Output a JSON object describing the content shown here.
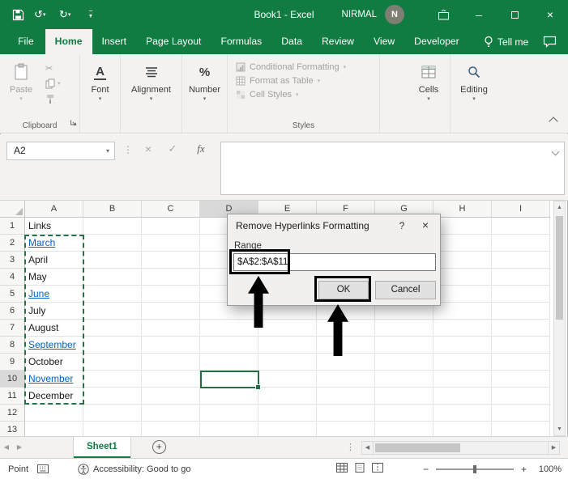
{
  "titlebar": {
    "title": "Book1 - Excel",
    "user": "NIRMAL",
    "avatar_initial": "N"
  },
  "tabs": {
    "file": "File",
    "items": [
      "Home",
      "Insert",
      "Page Layout",
      "Formulas",
      "Data",
      "Review",
      "View",
      "Developer"
    ],
    "active": "Home",
    "tell_me": "Tell me"
  },
  "ribbon": {
    "paste_label": "Paste",
    "clipboard_group": "Clipboard",
    "font_label": "Font",
    "alignment_label": "Alignment",
    "number_label": "Number",
    "styles": {
      "conditional_formatting": "Conditional Formatting",
      "format_as_table": "Format as Table",
      "cell_styles": "Cell Styles",
      "group_label": "Styles"
    },
    "cells_label": "Cells",
    "editing_label": "Editing"
  },
  "formula_bar": {
    "name_box": "A2",
    "fx_label": "fx"
  },
  "grid": {
    "column_headers": [
      "A",
      "B",
      "C",
      "D",
      "E",
      "F",
      "G",
      "H",
      "I"
    ],
    "row_headers": [
      "1",
      "2",
      "3",
      "4",
      "5",
      "6",
      "7",
      "8",
      "9",
      "10",
      "11",
      "12",
      "13"
    ],
    "column_a": [
      {
        "row": "1",
        "text": "Links",
        "hyperlink": false
      },
      {
        "row": "2",
        "text": "March",
        "hyperlink": true
      },
      {
        "row": "3",
        "text": "April",
        "hyperlink": false
      },
      {
        "row": "4",
        "text": "May",
        "hyperlink": false
      },
      {
        "row": "5",
        "text": "June",
        "hyperlink": true
      },
      {
        "row": "6",
        "text": "July",
        "hyperlink": false
      },
      {
        "row": "7",
        "text": "August",
        "hyperlink": false
      },
      {
        "row": "8",
        "text": "September",
        "hyperlink": true
      },
      {
        "row": "9",
        "text": "October",
        "hyperlink": false
      },
      {
        "row": "10",
        "text": "November",
        "hyperlink": true
      },
      {
        "row": "11",
        "text": "December",
        "hyperlink": false
      }
    ],
    "active_cell": "D10",
    "selection_range": "A2:A11"
  },
  "dialog": {
    "title": "Remove Hyperlinks Formatting",
    "range_label": "Range",
    "range_value": "$A$2:$A$11",
    "ok_label": "OK",
    "cancel_label": "Cancel"
  },
  "sheet_bar": {
    "sheet_name": "Sheet1"
  },
  "status_bar": {
    "mode": "Point",
    "accessibility": "Accessibility: Good to go",
    "zoom": "100%"
  },
  "icons": {
    "undo": "↺",
    "redo": "↻",
    "dropdown": "▾",
    "close": "×",
    "minimize": "–",
    "check": "✓",
    "scissors": "✂",
    "up": "▲",
    "down": "▼",
    "left": "◀",
    "right": "▶",
    "plus": "+",
    "minus": "−",
    "question": "?",
    "dots": "⋮",
    "percent": "%",
    "font_a": "A"
  },
  "colors": {
    "excel_green": "#107C41",
    "hyperlink_blue": "#0563C1",
    "active_cell_border": "#1E7145"
  }
}
